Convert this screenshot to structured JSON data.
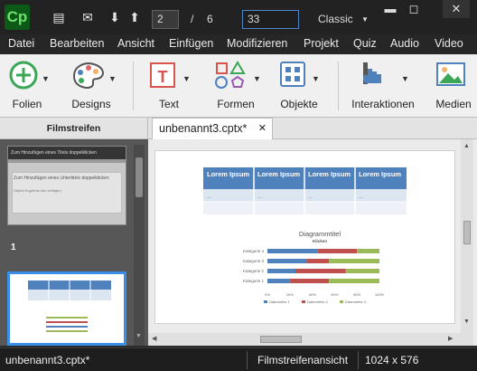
{
  "app": {
    "logo": "Cp"
  },
  "toolbar": {
    "page_current": "2",
    "page_separator": "/",
    "page_total": "6",
    "zoom_value": "33",
    "workspace": "Classic"
  },
  "menu": [
    "Datei",
    "Bearbeiten",
    "Ansicht",
    "Einfügen",
    "Modifizieren",
    "Projekt",
    "Quiz",
    "Audio",
    "Video"
  ],
  "ribbon": {
    "folien": "Folien",
    "designs": "Designs",
    "text": "Text",
    "formen": "Formen",
    "objekte": "Objekte",
    "interaktionen": "Interaktionen",
    "medien": "Medien"
  },
  "filmstrip": {
    "header": "Filmstreifen",
    "slide1_number": "1",
    "slide1_title": "Zum Hinzufügen eines Titels doppelklicken",
    "slide1_body": "Zum Hinzufügen eines Untertitels doppelklicken",
    "slide1_body2": "Objekt Ergebnis hier einfügen"
  },
  "document_tab": {
    "label": "unbenannt3.cptx*"
  },
  "slide": {
    "table_headers": [
      "Lorem Ipsum",
      "Lorem Ipsum",
      "Lorem Ipsum",
      "Lorem Ipsum"
    ],
    "table_rows": [
      [
        "...",
        "...",
        "...",
        "..."
      ],
      [
        "",
        "",
        "",
        ""
      ]
    ],
    "chart_data": {
      "type": "bar",
      "title": "Diagrammtitel",
      "subtitle": "Klicken",
      "categories": [
        "Kategorie 4",
        "Kategorie 3",
        "Kategorie 2",
        "Kategorie 1"
      ],
      "series": [
        {
          "name": "Datenreihe 1",
          "values": [
            45,
            35,
            25,
            20
          ]
        },
        {
          "name": "Datenreihe 2",
          "values": [
            35,
            20,
            45,
            35
          ]
        },
        {
          "name": "Datenreihe 3",
          "values": [
            20,
            45,
            30,
            45
          ]
        }
      ],
      "xticks": [
        "0%",
        "20%",
        "40%",
        "60%",
        "80%",
        "100%"
      ],
      "colors": [
        "#4f81bd",
        "#c0504d",
        "#9bbb59"
      ]
    }
  },
  "status": {
    "filename": "unbenannt3.cptx*",
    "view": "Filmstreifenansicht",
    "resolution": "1024 x 576"
  }
}
